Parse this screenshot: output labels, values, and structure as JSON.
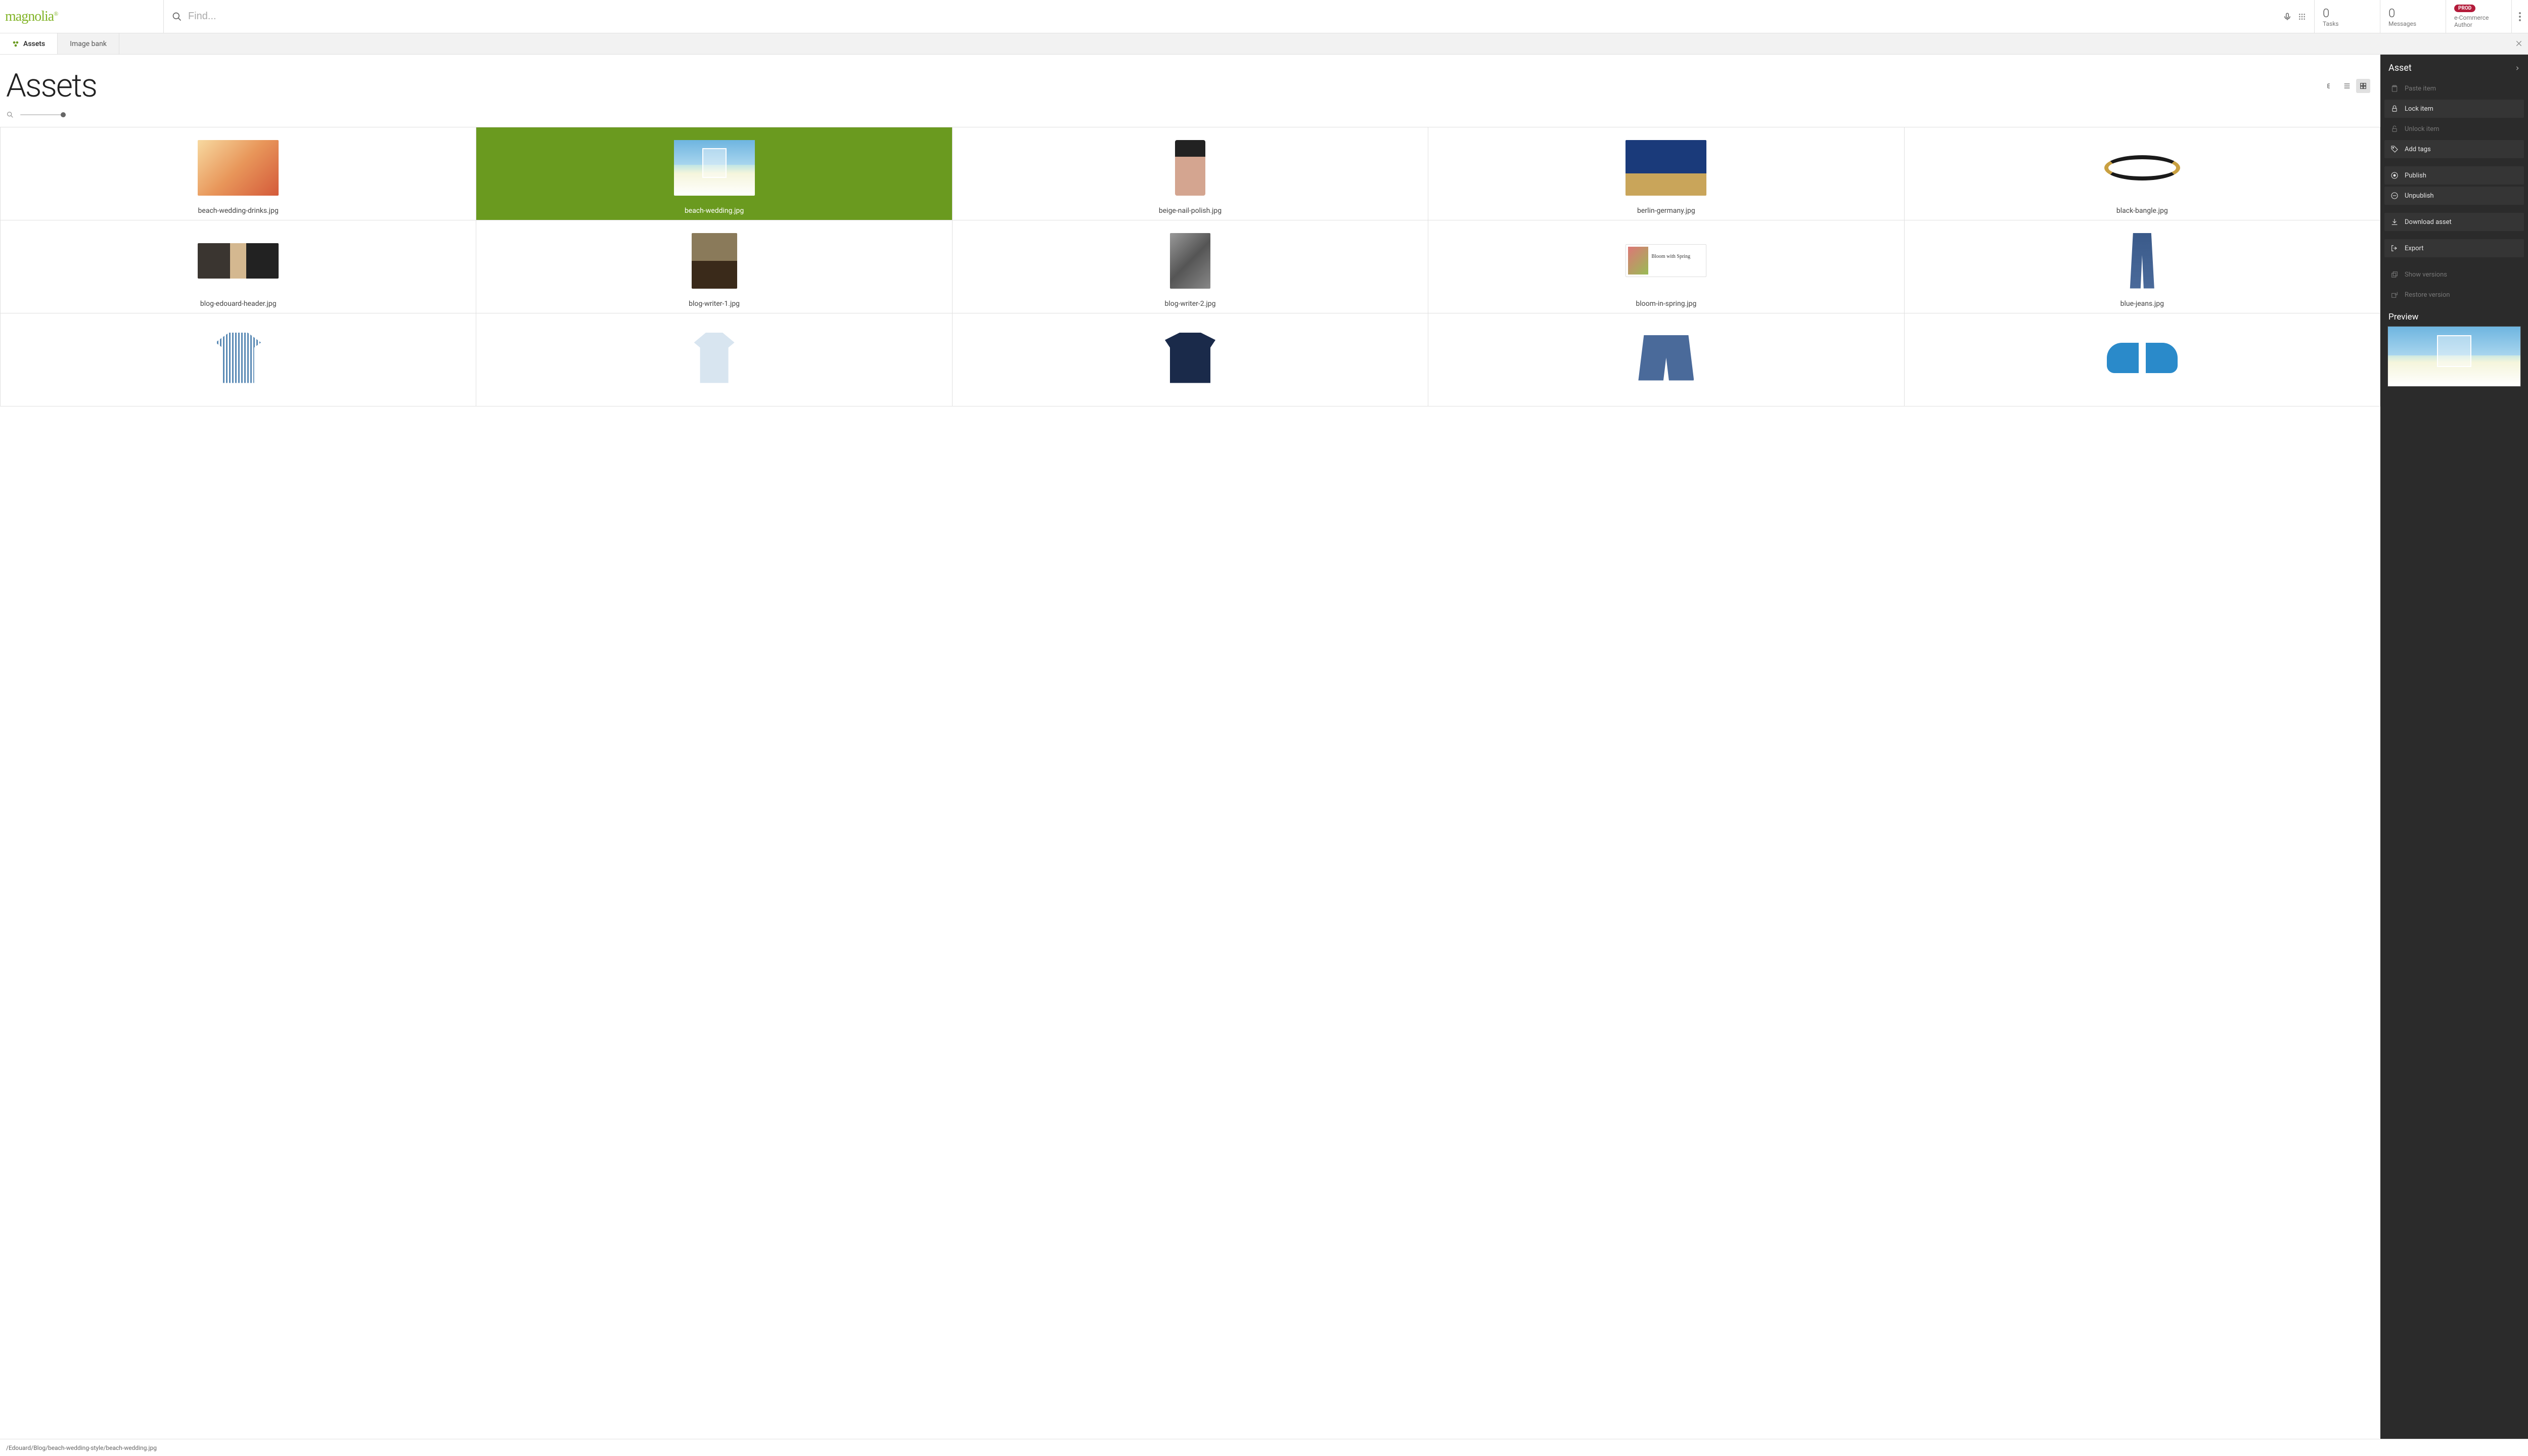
{
  "header": {
    "logo": "magnolia",
    "search_placeholder": "Find...",
    "tasks": {
      "count": "0",
      "label": "Tasks"
    },
    "messages": {
      "count": "0",
      "label": "Messages"
    },
    "env": {
      "badge": "PROD",
      "role": "e-Commerce Author"
    }
  },
  "tabs": [
    {
      "label": "Assets",
      "active": true
    },
    {
      "label": "Image bank",
      "active": false
    }
  ],
  "page": {
    "title": "Assets"
  },
  "assets": [
    {
      "name": "beach-wedding-drinks.jpg",
      "thumb": "drinks",
      "selected": false
    },
    {
      "name": "beach-wedding.jpg",
      "thumb": "wedding",
      "selected": true
    },
    {
      "name": "beige-nail-polish.jpg",
      "thumb": "polish",
      "selected": false
    },
    {
      "name": "berlin-germany.jpg",
      "thumb": "berlin",
      "selected": false
    },
    {
      "name": "black-bangle.jpg",
      "thumb": "bangle",
      "selected": false
    },
    {
      "name": "blog-edouard-header.jpg",
      "thumb": "headshot",
      "selected": false
    },
    {
      "name": "blog-writer-1.jpg",
      "thumb": "writer1",
      "selected": false
    },
    {
      "name": "blog-writer-2.jpg",
      "thumb": "writer2",
      "selected": false
    },
    {
      "name": "bloom-in-spring.jpg",
      "thumb": "bloom",
      "selected": false
    },
    {
      "name": "blue-jeans.jpg",
      "thumb": "jeans",
      "selected": false
    },
    {
      "name": "",
      "thumb": "shirt1",
      "selected": false
    },
    {
      "name": "",
      "thumb": "shirt2",
      "selected": false
    },
    {
      "name": "",
      "thumb": "sweater",
      "selected": false
    },
    {
      "name": "",
      "thumb": "shorts",
      "selected": false
    },
    {
      "name": "",
      "thumb": "sandals",
      "selected": false
    }
  ],
  "sidebar": {
    "title": "Asset",
    "actions": [
      {
        "label": "Paste item",
        "icon": "paste",
        "enabled": false
      },
      {
        "label": "Lock item",
        "icon": "lock",
        "enabled": true
      },
      {
        "label": "Unlock item",
        "icon": "unlock",
        "enabled": false
      },
      {
        "label": "Add tags",
        "icon": "tag",
        "enabled": true
      }
    ],
    "publish": [
      {
        "label": "Publish",
        "icon": "publish",
        "enabled": true
      },
      {
        "label": "Unpublish",
        "icon": "unpublish",
        "enabled": true
      }
    ],
    "download": {
      "label": "Download asset",
      "icon": "download",
      "enabled": true
    },
    "export": {
      "label": "Export",
      "icon": "export",
      "enabled": true
    },
    "versions": [
      {
        "label": "Show versions",
        "icon": "versions",
        "enabled": false
      },
      {
        "label": "Restore version",
        "icon": "restore",
        "enabled": false
      }
    ],
    "preview_title": "Preview"
  },
  "status": {
    "path": "/Edouard/Blog/beach-wedding-style/beach-wedding.jpg"
  },
  "colors": {
    "accent": "#6a9a1f",
    "prod_badge": "#b31b3a"
  }
}
